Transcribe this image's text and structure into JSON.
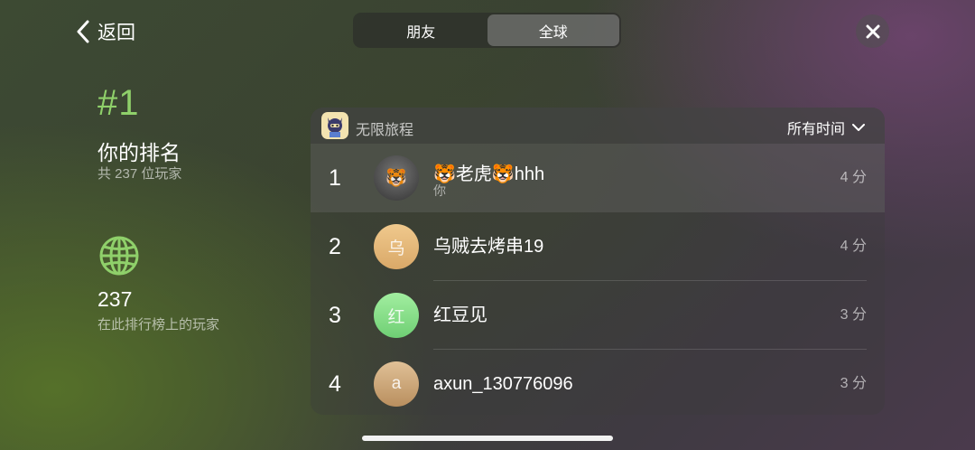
{
  "nav": {
    "back_label": "返回"
  },
  "tabs": [
    {
      "label": "朋友",
      "active": false
    },
    {
      "label": "全球",
      "active": true
    }
  ],
  "summary": {
    "rank": "#1",
    "rank_title": "你的排名",
    "rank_sub": "共 237 位玩家",
    "player_count": "237",
    "player_count_sub": "在此排行榜上的玩家"
  },
  "leaderboard": {
    "game_name": "无限旅程",
    "filter_label": "所有时间",
    "rows": [
      {
        "position": "1",
        "name": "🐯老虎🐯hhh",
        "subtitle": "你",
        "score": "4 分",
        "avatar": "🐯"
      },
      {
        "position": "2",
        "name": "乌贼去烤串19",
        "score": "4 分",
        "avatar": "乌"
      },
      {
        "position": "3",
        "name": "红豆见",
        "score": "3 分",
        "avatar": "红"
      },
      {
        "position": "4",
        "name": "axun_130776096",
        "score": "3 分",
        "avatar": "a"
      }
    ]
  },
  "colors": {
    "rank_accent": "#8fd06a",
    "avatar_2": "#e8b97a",
    "avatar_3": "#8de08a",
    "avatar_4": "#cfa978"
  },
  "icons": [
    "chevron-left-icon",
    "close-icon",
    "globe-icon",
    "chevron-down-icon",
    "game-icon"
  ]
}
